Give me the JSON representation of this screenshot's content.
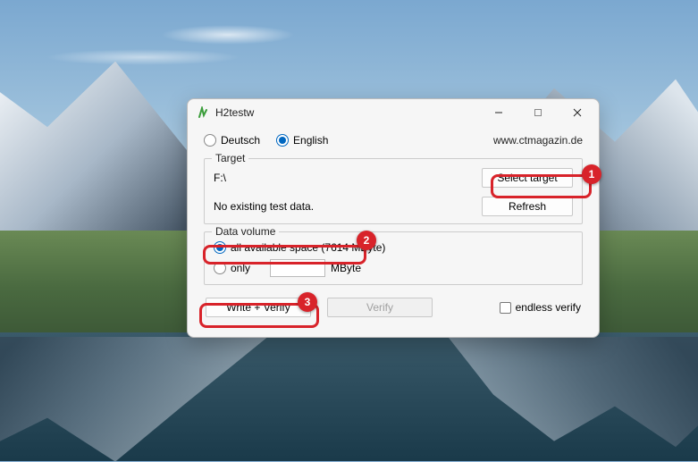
{
  "window": {
    "title": "H2testw"
  },
  "lang": {
    "de": "Deutsch",
    "en": "English"
  },
  "link": "www.ctmagazin.de",
  "target": {
    "group_label": "Target",
    "path": "F:\\",
    "select_btn": "Select target",
    "status": "No existing test data.",
    "refresh_btn": "Refresh"
  },
  "datavol": {
    "group_label": "Data volume",
    "all_label": "all available space (7614 MByte)",
    "only_label": "only",
    "only_unit": "MByte"
  },
  "actions": {
    "write_verify": "Write + Verify",
    "verify": "Verify",
    "endless": "endless verify"
  },
  "annotations": {
    "1": "1",
    "2": "2",
    "3": "3"
  }
}
